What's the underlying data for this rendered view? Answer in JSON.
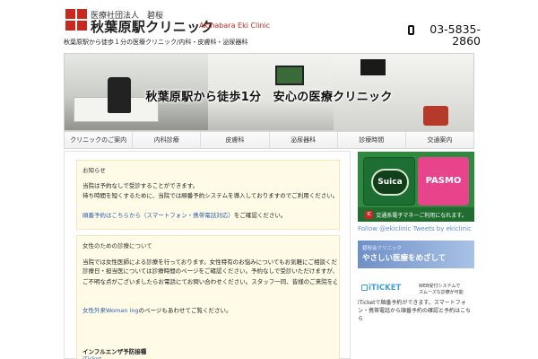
{
  "header": {
    "org": "医療社団法人　碧桜",
    "clinic_name": "秋葉原駅クリニック",
    "clinic_en": "Akihabara Eki Clinic",
    "phone_line1": "03-5835-",
    "phone_line2": "2860",
    "tagline": "秋葉原駅から徒歩１分の医療クリニック/内科・皮膚科・泌尿器科",
    "phone_icon": "phone-icon"
  },
  "hero": {
    "text": "秋葉原駅から徒歩1分　安心の医療クリニック"
  },
  "nav": {
    "items": [
      "クリニックのご案内",
      "内科診療",
      "皮膚科",
      "泌尿器科",
      "診療時間",
      "交通案内"
    ]
  },
  "main": {
    "card1": {
      "heading": "お知らせ",
      "line1": "当院は予約なしで受診することができます。",
      "line2": "待ち時間を短くするために、当院では順番予約システムを導入しておりますのでご利用ください。",
      "link": "順番予約はこちらから（スマートフォン・携帯電話対応）",
      "link_suffix": "をご確認ください。"
    },
    "card2": {
      "heading": "女性のための診療について",
      "line1": "当院では女性医師による診療を行っております。女性特有のお悩みについてもお気軽にご相談ください。プライバシーに配慮した診療を心がけております。",
      "line2": "診療日・担当医については診療時間のページをご確認ください。予約なしで受診いただけますが、混雑時はお待ちいただく場合がございます。",
      "line3": "ご不明な点がございましたらお電話にてお問い合わせください。スタッフ一同、皆様のご来院を心よりお待ちしております。",
      "link": "女性外来Woman ing",
      "link_suffix": "のページもあわせてご覧ください。",
      "bold_line": "インフルエンザ予防接種",
      "tail": "iTicket"
    }
  },
  "sidebar": {
    "suica": "Suica",
    "pasmo": "PASMO",
    "ic_badge": "IC",
    "pay_caption": "交通系電子マネーご利用になれます。",
    "twitter_link1": "Follow @ekiclinic",
    "twitter_link2": "Tweets by ekiclinic",
    "banner_small": "碧桜会クリニック",
    "banner_big": "やさしい医療をめざして",
    "iticket_logo": "iTICKET",
    "iticket_note1": "WEB受付システムで",
    "iticket_note2": "スムーズな診療が可能",
    "iticket_desc": "iTicketで順番予約ができます。スマートフォン・携帯電話から順番予約の確認と予約はこちら"
  }
}
